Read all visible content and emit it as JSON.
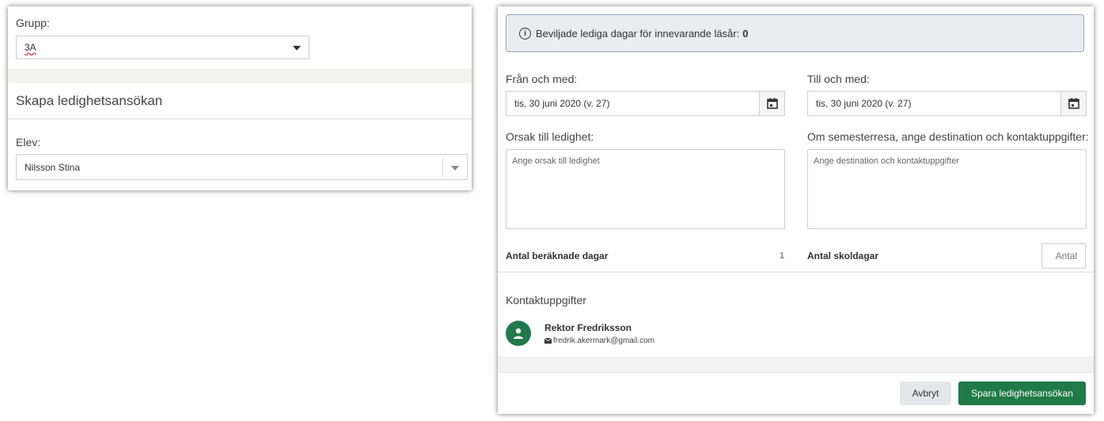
{
  "left_panel": {
    "group_label": "Grupp:",
    "group_value": "3A",
    "section_title": "Skapa ledighetsansökan",
    "student_label": "Elev:",
    "student_value": "Nilsson Stina"
  },
  "right_panel": {
    "info_text": "Beviljade lediga dagar för innevarande läsår:",
    "info_value": "0",
    "from_label": "Från och med:",
    "from_value": "tis, 30 juni 2020 (v. 27)",
    "to_label": "Till och med:",
    "to_value": "tis, 30 juni 2020 (v. 27)",
    "reason_label": "Orsak till ledighet:",
    "reason_placeholder": "Ange orsak till ledighet",
    "destination_label": "Om semesterresa, ange destination och kontaktuppgifter:",
    "destination_placeholder": "Ange destination och kontaktuppgifter",
    "calc_days_label": "Antal beräknade dagar",
    "calc_days_value": "1",
    "school_days_label": "Antal skoldagar",
    "school_days_placeholder": "Antal",
    "contact_title": "Kontaktuppgifter",
    "contact_name": "Rektor Fredriksson",
    "contact_email": "fredrik.akermark@gmail.com",
    "cancel_label": "Avbryt",
    "save_label": "Spara ledighetsansökan"
  },
  "colors": {
    "accent_green": "#1e7a47",
    "avatar_green": "#217a4b"
  }
}
